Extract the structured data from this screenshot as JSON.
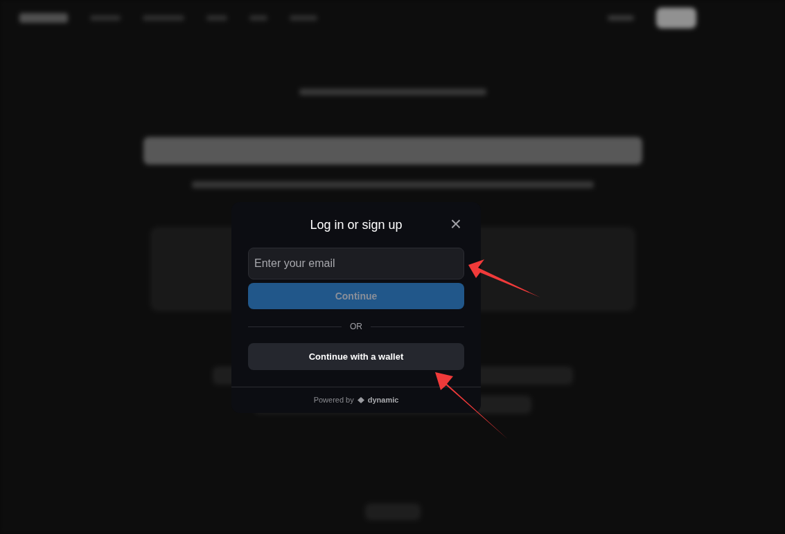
{
  "modal": {
    "title": "Log in or sign up",
    "close": "×",
    "email": {
      "placeholder": "Enter your email"
    },
    "continue_button": {
      "label": "Continue",
      "disabled": true
    },
    "divider": "OR",
    "wallet_button": "Continue with a wallet",
    "footer": {
      "powered_by": "Powered by",
      "brand": "dynamic"
    }
  },
  "annotations": [
    {
      "kind": "arrow"
    },
    {
      "kind": "arrow"
    }
  ]
}
